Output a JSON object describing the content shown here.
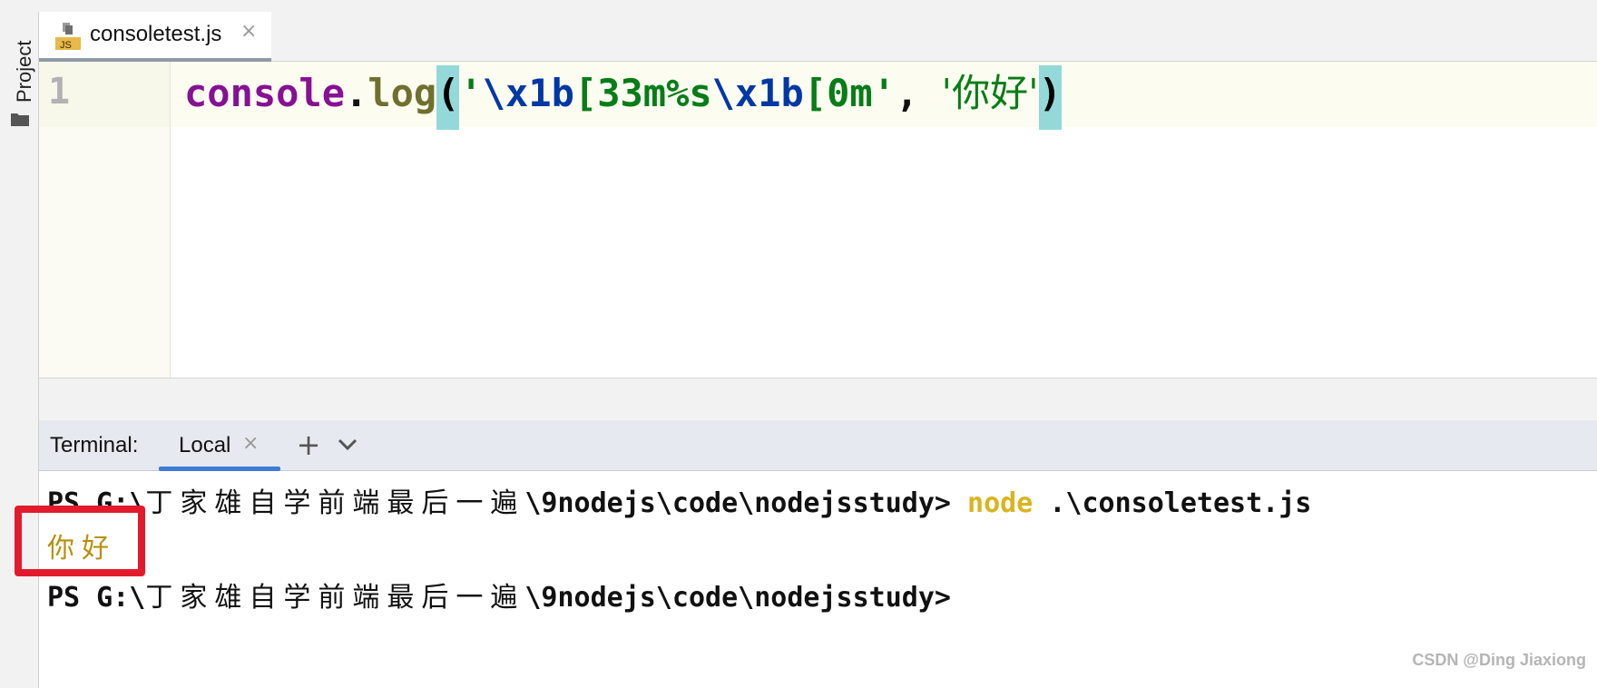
{
  "sidebar": {
    "project_label": "Project"
  },
  "editor": {
    "tab": {
      "icon_label": "JS",
      "filename": "consoletest.js",
      "close_glyph": "×"
    },
    "line_number": "1",
    "code": {
      "ident": "console",
      "dot": ".",
      "method": "log",
      "open_paren": "(",
      "q1": "'",
      "esc1": "\\x1b",
      "fmt": "[33m%s",
      "esc2": "\\x1b",
      "reset": "[0m",
      "q2": "'",
      "comma": ", ",
      "str_arg": "'你好'",
      "close_paren": ")"
    }
  },
  "terminal": {
    "title": "Terminal:",
    "tab_label": "Local",
    "tab_close": "×",
    "new_tab": "+",
    "prompt_prefix": "PS G:\\",
    "prompt_cjk": "丁家雄自学前端最后一遍",
    "prompt_rest": "\\9nodejs\\code\\nodejsstudy>",
    "command_node": "node",
    "command_arg": " .\\consoletest.js",
    "output": "你好"
  },
  "watermark": "CSDN @Ding Jiaxiong",
  "colors": {
    "keyword_purple": "#871094",
    "string_green": "#067d17",
    "escape_blue": "#0037a6",
    "paren_highlight": "#93d9d9",
    "terminal_yellow": "#d9b41f",
    "annotation_red": "#e21b2c",
    "tab_accent": "#3d7bd6"
  }
}
